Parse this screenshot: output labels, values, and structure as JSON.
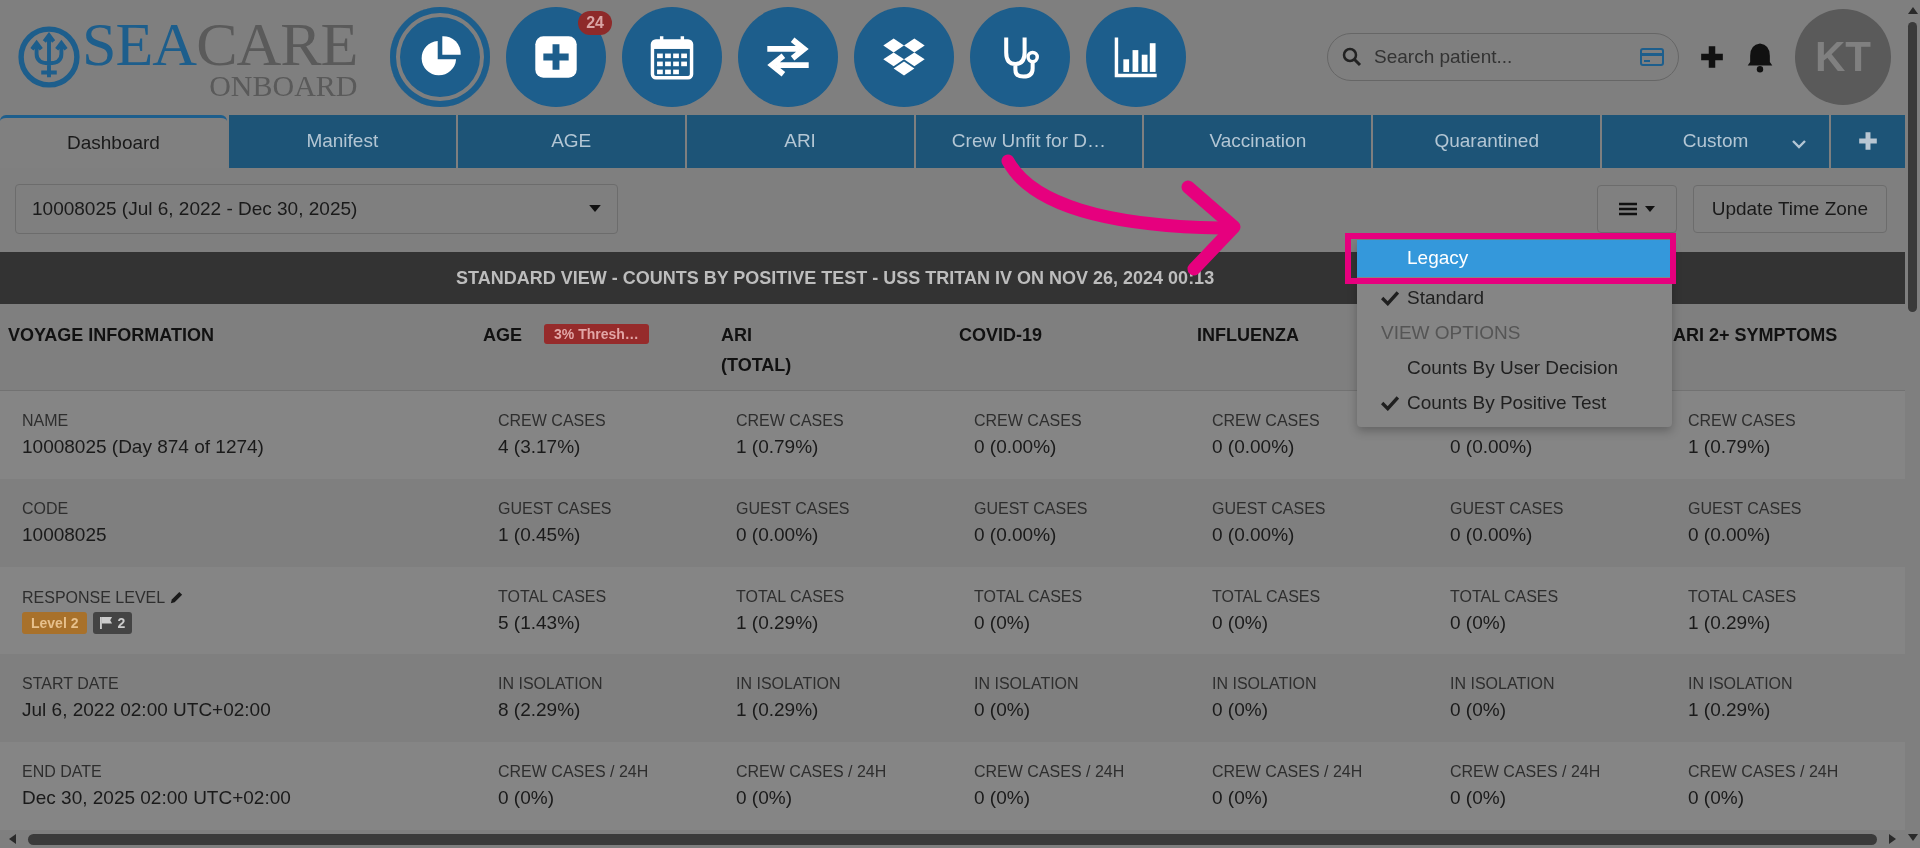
{
  "logo": {
    "part_1": "SEA",
    "part_2": "CARE",
    "tagline": "ONBOARD"
  },
  "nav_icons": [
    {
      "kind": "pie"
    },
    {
      "kind": "add",
      "badge": "24"
    },
    {
      "kind": "calendar"
    },
    {
      "kind": "transfer"
    },
    {
      "kind": "boxes"
    },
    {
      "kind": "stethoscope"
    },
    {
      "kind": "chart"
    }
  ],
  "search": {
    "placeholder": "Search patient..."
  },
  "avatar": "KT",
  "tabs": [
    {
      "label": "Dashboard",
      "selected": true,
      "kind": "plain"
    },
    {
      "label": "Manifest",
      "selected": false,
      "kind": "plain"
    },
    {
      "label": "AGE",
      "selected": false,
      "kind": "plain"
    },
    {
      "label": "ARI",
      "selected": false,
      "kind": "plain"
    },
    {
      "label": "Crew Unfit for D…",
      "selected": false,
      "kind": "plain"
    },
    {
      "label": "Vaccination",
      "selected": false,
      "kind": "plain"
    },
    {
      "label": "Quarantined",
      "selected": false,
      "kind": "plain"
    },
    {
      "label": "Custom",
      "selected": false,
      "kind": "menu"
    }
  ],
  "voyage_select": {
    "value": "10008025 (Jul 6, 2022 - Dec 30, 2025)"
  },
  "update_button": "Update Time Zone",
  "banner": "STANDARD VIEW - COUNTS BY POSITIVE TEST - USS TRITAN IV ON NOV 26, 2024 00:13",
  "columns": [
    {
      "title_lines": [
        "VOYAGE INFORMATION"
      ]
    },
    {
      "title_lines": [
        "AGE"
      ],
      "badge": "3% Thresh…"
    },
    {
      "title_lines": [
        "ARI",
        "(TOTAL)"
      ]
    },
    {
      "title_lines": [
        "COVID-19"
      ]
    },
    {
      "title_lines": [
        "INFLUENZA"
      ]
    },
    {},
    {
      "title_lines": [
        "ARI 2+ SYMPTOMS"
      ]
    }
  ],
  "rows": [
    {
      "info": {
        "kind": "text",
        "label": "NAME",
        "value": "10008025 (Day 874 of 1274)"
      },
      "cells": [
        {
          "label": "CREW CASES",
          "value": "4 (3.17%)"
        },
        {
          "label": "CREW CASES",
          "value": "1 (0.79%)"
        },
        {
          "label": "CREW CASES",
          "value": "0 (0.00%)"
        },
        {
          "label": "CREW CASES",
          "value": "0 (0.00%)"
        },
        {
          "value": "0 (0.00%)"
        },
        {
          "label": "CREW CASES",
          "value": "1 (0.79%)"
        }
      ]
    },
    {
      "info": {
        "kind": "text",
        "label": "CODE",
        "value": "10008025"
      },
      "cells": [
        {
          "label": "GUEST CASES",
          "value": "1 (0.45%)"
        },
        {
          "label": "GUEST CASES",
          "value": "0 (0.00%)"
        },
        {
          "label": "GUEST CASES",
          "value": "0 (0.00%)"
        },
        {
          "label": "GUEST CASES",
          "value": "0 (0.00%)"
        },
        {
          "label": "GUEST CASES",
          "value": "0 (0.00%)"
        },
        {
          "label": "GUEST CASES",
          "value": "0 (0.00%)"
        }
      ]
    },
    {
      "info": {
        "kind": "response",
        "label": "RESPONSE LEVEL",
        "level_badge": "Level 2",
        "flag_count": "2"
      },
      "cells": [
        {
          "label": "TOTAL CASES",
          "value": "5 (1.43%)"
        },
        {
          "label": "TOTAL CASES",
          "value": "1 (0.29%)"
        },
        {
          "label": "TOTAL CASES",
          "value": "0 (0%)"
        },
        {
          "label": "TOTAL CASES",
          "value": "0 (0%)"
        },
        {
          "label": "TOTAL CASES",
          "value": "0 (0%)"
        },
        {
          "label": "TOTAL CASES",
          "value": "1 (0.29%)"
        }
      ]
    },
    {
      "info": {
        "kind": "text",
        "label": "START DATE",
        "value": "Jul 6, 2022 02:00 UTC+02:00"
      },
      "cells": [
        {
          "label": "IN ISOLATION",
          "value": "8 (2.29%)"
        },
        {
          "label": "IN ISOLATION",
          "value": "1 (0.29%)"
        },
        {
          "label": "IN ISOLATION",
          "value": "0 (0%)"
        },
        {
          "label": "IN ISOLATION",
          "value": "0 (0%)"
        },
        {
          "label": "IN ISOLATION",
          "value": "0 (0%)"
        },
        {
          "label": "IN ISOLATION",
          "value": "1 (0.29%)"
        }
      ]
    },
    {
      "info": {
        "kind": "text",
        "label": "END DATE",
        "value": "Dec 30, 2025 02:00 UTC+02:00"
      },
      "cells": [
        {
          "label": "CREW CASES / 24H",
          "value": "0 (0%)"
        },
        {
          "label": "CREW CASES / 24H",
          "value": "0 (0%)"
        },
        {
          "label": "CREW CASES / 24H",
          "value": "0 (0%)"
        },
        {
          "label": "CREW CASES / 24H",
          "value": "0 (0%)"
        },
        {
          "label": "CREW CASES / 24H",
          "value": "0 (0%)"
        },
        {
          "label": "CREW CASES / 24H",
          "value": "0 (0%)"
        }
      ]
    }
  ],
  "view_menu": [
    {
      "kind": "option",
      "label": "Legacy",
      "checked": false,
      "selected": true
    },
    {
      "kind": "option",
      "label": "Standard",
      "checked": true,
      "selected": false
    },
    {
      "kind": "header",
      "label": "VIEW OPTIONS"
    },
    {
      "kind": "option",
      "label": "Counts By User Decision",
      "checked": false,
      "selected": false
    },
    {
      "kind": "option",
      "label": "Counts By Positive Test",
      "checked": true,
      "selected": false
    }
  ]
}
